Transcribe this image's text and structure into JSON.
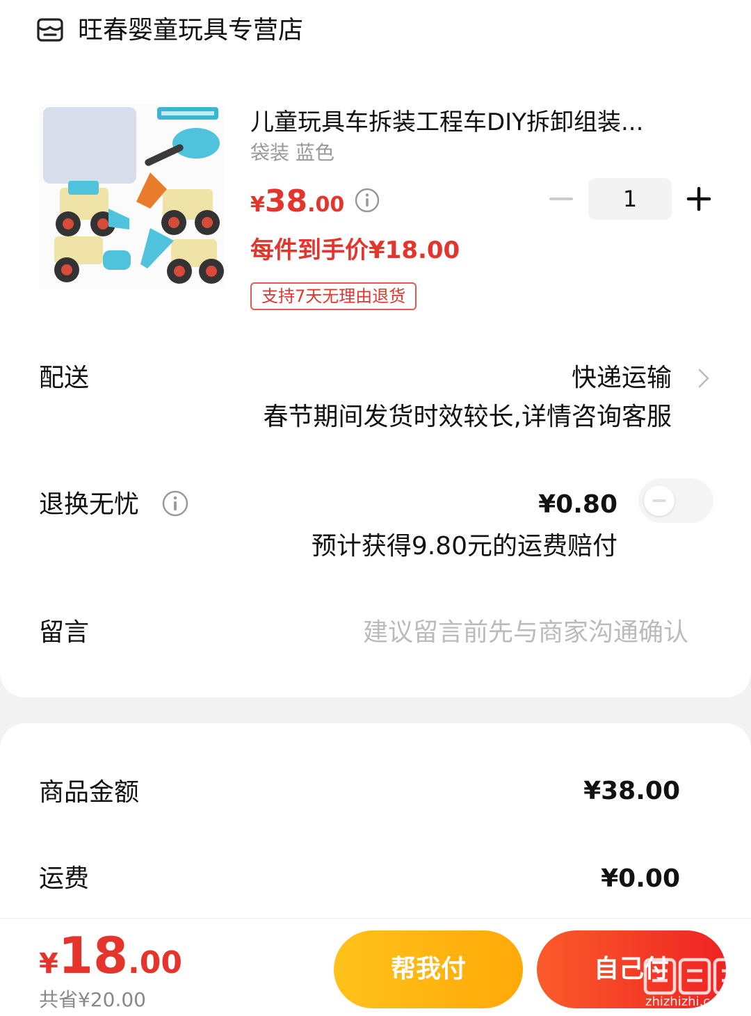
{
  "store": {
    "name": "旺春婴童玩具专营店",
    "icon": "store-icon"
  },
  "product": {
    "title": "儿童玩具车拆装工程车DIY拆卸组装...",
    "sku": "袋装 蓝色",
    "price_currency": "¥",
    "price_int": "38",
    "price_dec": ".00",
    "quantity": "1",
    "deal_price": "每件到手价¥18.00",
    "return_badge": "支持7天无理由退货",
    "image_label": "工程车玩具套装"
  },
  "delivery": {
    "label": "配送",
    "value": "快递运输",
    "note": "春节期间发货时效较长,详情咨询客服"
  },
  "worry_free": {
    "label": "退换无忧",
    "price": "¥0.80",
    "note": "预计获得9.80元的运费赔付",
    "enabled": false
  },
  "message": {
    "label": "留言",
    "placeholder": "建议留言前先与商家沟通确认"
  },
  "summary": {
    "goods_label": "商品金额",
    "goods_value": "¥38.00",
    "shipping_label": "运费",
    "shipping_value": "¥0.00"
  },
  "footer": {
    "total_currency": "¥",
    "total_int": "18",
    "total_dec": ".00",
    "saved": "共省¥20.00",
    "help_pay": "帮我付",
    "self_pay": "自己付"
  },
  "watermark": {
    "text": "值值值",
    "url": "zhizhizhi.com"
  },
  "colors": {
    "accent_red": "#e5342c",
    "orange": "#ffb20f",
    "red_button": "#f23b26"
  }
}
